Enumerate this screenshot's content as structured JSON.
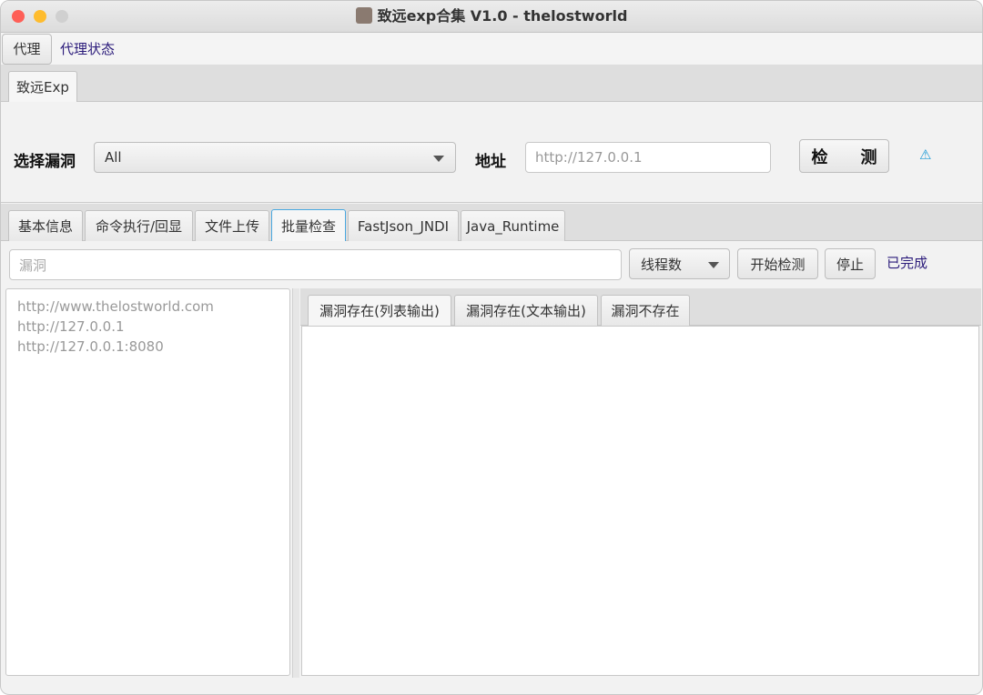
{
  "window": {
    "title": "致远exp合集 V1.0 - thelostworld"
  },
  "menubar": {
    "proxy_button": "代理",
    "proxy_status": "代理状态"
  },
  "top_tabs": [
    {
      "label": "致远Exp"
    }
  ],
  "form": {
    "vuln_label": "选择漏洞",
    "vuln_selected": "All",
    "addr_label": "地址",
    "addr_placeholder": "http://127.0.0.1",
    "detect_button": "检　　测",
    "warning_icon": "⚠"
  },
  "sub_tabs": [
    {
      "label": "基本信息"
    },
    {
      "label": "命令执行/回显"
    },
    {
      "label": "文件上传"
    },
    {
      "label": "批量检查"
    },
    {
      "label": "FastJson_JNDI"
    },
    {
      "label": "Java_Runtime"
    }
  ],
  "batch": {
    "filter_placeholder": "漏洞",
    "threads_select": "线程数",
    "start_button": "开始检测",
    "stop_button": "停止",
    "status": "已完成",
    "urls": [
      "http://www.thelostworld.com",
      "http://127.0.0.1",
      "http://127.0.0.1:8080"
    ],
    "result_tabs": [
      {
        "label": "漏洞存在(列表输出)"
      },
      {
        "label": "漏洞存在(文本输出)"
      },
      {
        "label": "漏洞不存在"
      }
    ]
  }
}
